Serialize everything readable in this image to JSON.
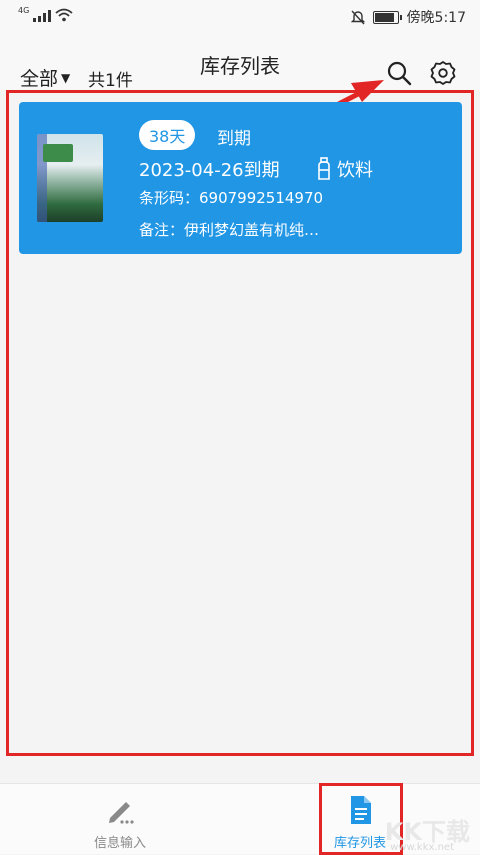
{
  "status_bar": {
    "network": "4G",
    "time": "傍晚5:17"
  },
  "header": {
    "filter_label": "全部",
    "count_label": "共1件",
    "title": "库存列表"
  },
  "items": [
    {
      "days_left": "38天",
      "expire_word": "到期",
      "expire_date": "2023-04-26到期",
      "category": "饮料",
      "barcode": "条形码：6907992514970",
      "note": "备注：伊利梦幻盖有机纯…"
    }
  ],
  "nav": [
    {
      "label": "信息输入",
      "icon": "pencil-icon",
      "active": false
    },
    {
      "label": "库存列表",
      "icon": "document-icon",
      "active": true
    }
  ],
  "watermark": {
    "text": "KK下载",
    "url": "www.kkx.net"
  },
  "colors": {
    "accent": "#2196e5",
    "highlight": "#e22525",
    "nav_inactive": "#8a8a8a"
  }
}
